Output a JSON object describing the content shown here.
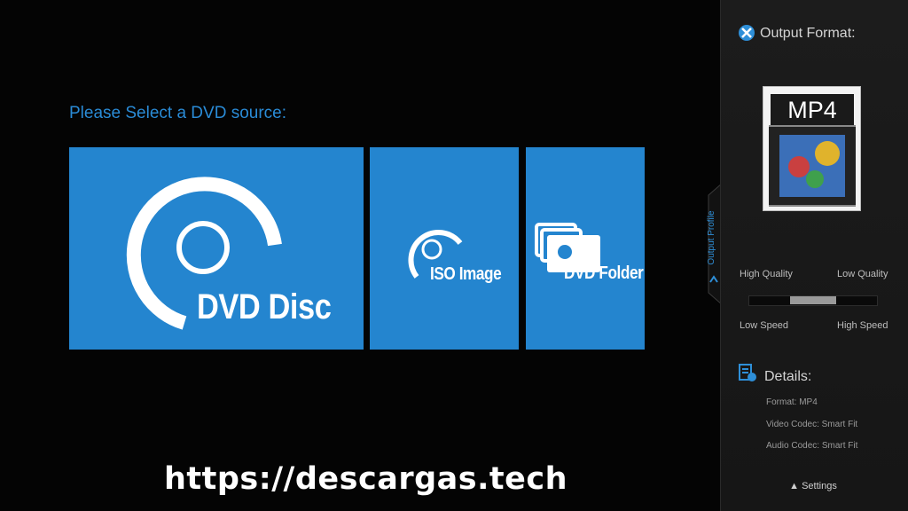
{
  "main": {
    "prompt": "Please Select a DVD source:",
    "tiles": [
      {
        "label": "DVD Disc"
      },
      {
        "label": "ISO Image"
      },
      {
        "label": "DVD Folder"
      }
    ]
  },
  "watermark": "https://descargas.tech",
  "side": {
    "output_format_title": "Output Format:",
    "format_badge": "MP4",
    "output_profile_tab": "Output Profile",
    "quality": {
      "high": "High Quality",
      "low": "Low Quality"
    },
    "speed": {
      "low": "Low Speed",
      "high": "High Speed"
    },
    "slider_value": 0.5,
    "details_title": "Details:",
    "details": {
      "format": "Format: MP4",
      "video_codec": "Video Codec: Smart Fit",
      "audio_codec": "Audio Codec: Smart Fit"
    },
    "settings_button": "Settings"
  },
  "colors": {
    "accent": "#2485cf",
    "background": "#040404",
    "panel": "#1a1a1a"
  },
  "icons": [
    "disc-icon",
    "folder-icon",
    "output-format-icon",
    "details-icon",
    "chevron-up-icon"
  ]
}
